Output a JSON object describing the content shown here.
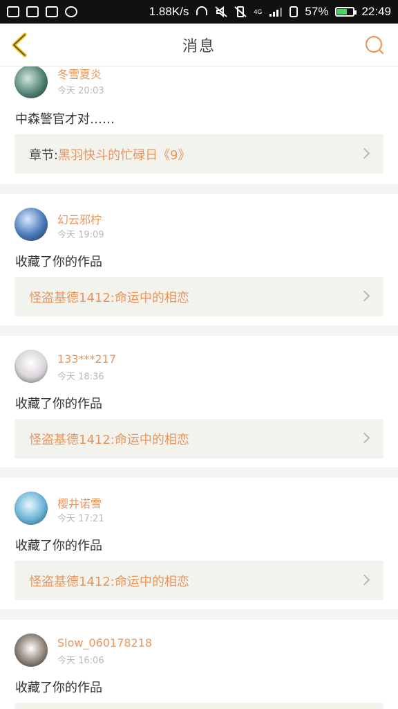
{
  "status_bar": {
    "net_speed": "1.88K/s",
    "network_type": "4G",
    "battery": "57%",
    "time": "22:49",
    "icons": [
      "image-icon",
      "shield-icon",
      "k-app-icon",
      "more-icon",
      "headphones-icon",
      "mute-icon",
      "vibrate-off-icon",
      "sim-icon",
      "signal-icon",
      "battery-icon"
    ]
  },
  "header": {
    "title": "消息"
  },
  "messages": [
    {
      "name": "冬雪夏炎",
      "time": "今天 20:03",
      "content": "中森警官才对……",
      "work_prefix": "章节:",
      "work_title": "黑羽快斗的忙碌日《9》"
    },
    {
      "name": "幻云邪柠",
      "time": "今天 19:09",
      "content": "收藏了你的作品",
      "work_prefix": "",
      "work_title": "怪盗基德1412:命运中的相恋"
    },
    {
      "name": "133***217",
      "time": "今天 18:36",
      "content": "收藏了你的作品",
      "work_prefix": "",
      "work_title": "怪盗基德1412:命运中的相恋"
    },
    {
      "name": "樱井诺雪",
      "time": "今天 17:21",
      "content": "收藏了你的作品",
      "work_prefix": "",
      "work_title": "怪盗基德1412:命运中的相恋"
    },
    {
      "name": "Slow_060178218",
      "time": "今天 16:06",
      "content": "收藏了你的作品",
      "work_prefix": "",
      "work_title": ""
    }
  ],
  "colors": {
    "accent": "#e9955c",
    "back_icon": "#e8b90c",
    "card_link_bg": "#f3f3ee"
  }
}
